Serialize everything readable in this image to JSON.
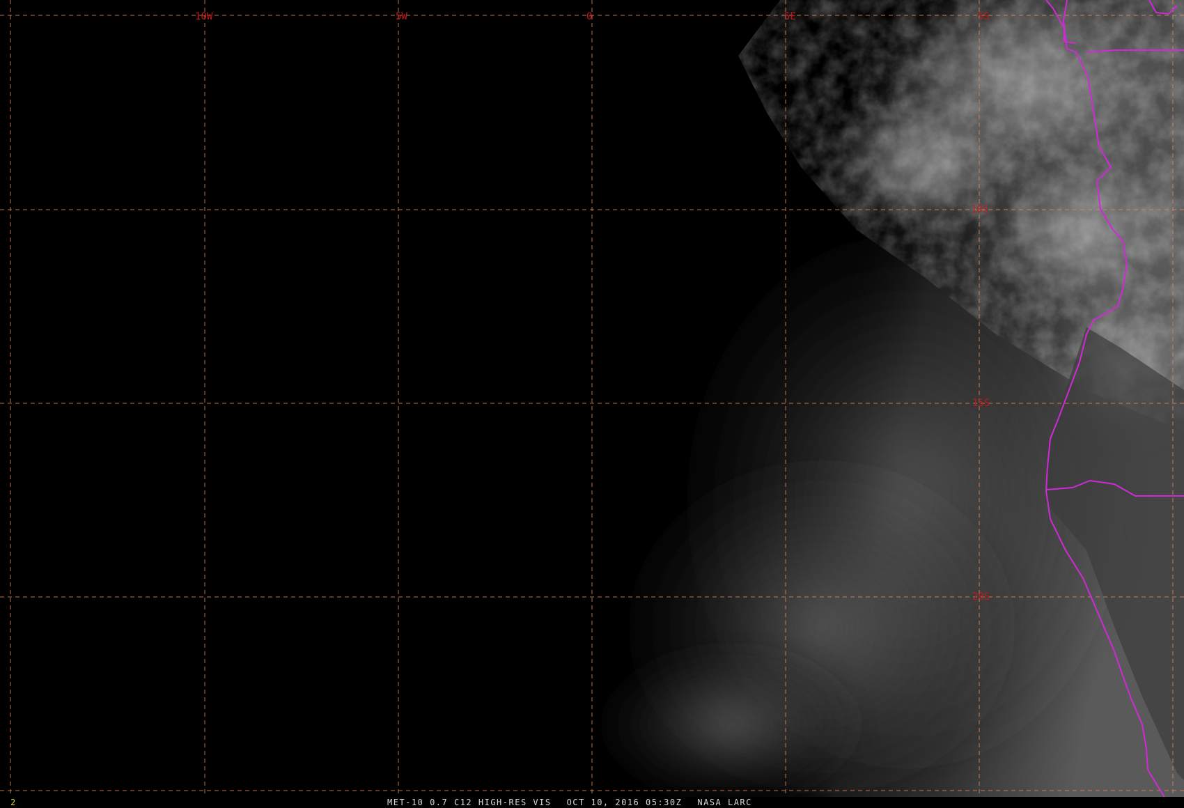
{
  "viewer": {
    "caption": {
      "product": "MET-10 0.7 C12 HIGH-RES VIS",
      "datetime": "OCT 10, 2016 05:30Z",
      "credit": "NASA LARC"
    },
    "frame_number": "2",
    "longitude_labels": [
      "10W",
      "5W",
      "0",
      "5E",
      "5S"
    ],
    "latitude_labels": [
      "10S",
      "15S",
      "20S"
    ],
    "colors": {
      "background": "#000000",
      "grid_line": "#d9895a",
      "grid_label": "#c21a1a",
      "border": "#d02ad8",
      "caption": "#d8d8d8",
      "frame_number": "#d8d030"
    }
  }
}
